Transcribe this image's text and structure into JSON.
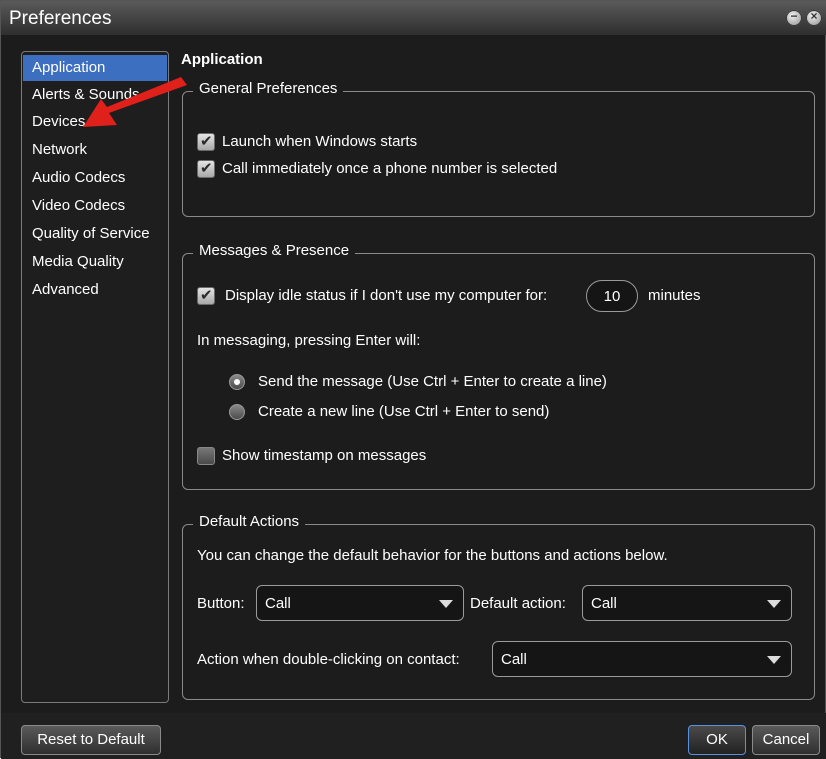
{
  "window": {
    "title": "Preferences"
  },
  "sidebar": {
    "items": [
      {
        "label": "Application",
        "active": true
      },
      {
        "label": "Alerts & Sounds",
        "active": false
      },
      {
        "label": "Devices",
        "active": false
      },
      {
        "label": "Network",
        "active": false
      },
      {
        "label": "Audio Codecs",
        "active": false
      },
      {
        "label": "Video Codecs",
        "active": false
      },
      {
        "label": "Quality of Service",
        "active": false
      },
      {
        "label": "Media Quality",
        "active": false
      },
      {
        "label": "Advanced",
        "active": false
      }
    ]
  },
  "main": {
    "title": "Application",
    "general": {
      "legend": "General Preferences",
      "launch_label": "Launch when Windows starts",
      "launch_checked": true,
      "call_label": "Call immediately once a phone number is selected",
      "call_checked": true
    },
    "messages": {
      "legend": "Messages & Presence",
      "idle_label": "Display idle status if I don't use my computer for:",
      "idle_checked": true,
      "idle_value": "10",
      "idle_unit": "minutes",
      "enter_label": "In messaging, pressing Enter will:",
      "radio_send_label": "Send the message (Use Ctrl + Enter to create a line)",
      "radio_send_selected": true,
      "radio_newline_label": "Create a new line (Use Ctrl + Enter to send)",
      "radio_newline_selected": false,
      "timestamp_label": "Show timestamp on messages",
      "timestamp_checked": false
    },
    "defaults": {
      "legend": "Default Actions",
      "description": "You can change the default behavior for the buttons and actions below.",
      "button_label": "Button:",
      "button_value": "Call",
      "default_action_label": "Default action:",
      "default_action_value": "Call",
      "double_click_label": "Action when double-clicking on contact:",
      "double_click_value": "Call"
    }
  },
  "footer": {
    "reset_label": "Reset to Default",
    "ok_label": "OK",
    "cancel_label": "Cancel"
  },
  "colors": {
    "accent": "#3d6fc1",
    "background": "#1c1c1c",
    "annotation_arrow": "#e0201a"
  },
  "icons": {
    "minimize": "minimize-icon",
    "close": "close-icon",
    "dropdown": "chevron-down-icon",
    "annotation": "red-arrow-icon"
  }
}
